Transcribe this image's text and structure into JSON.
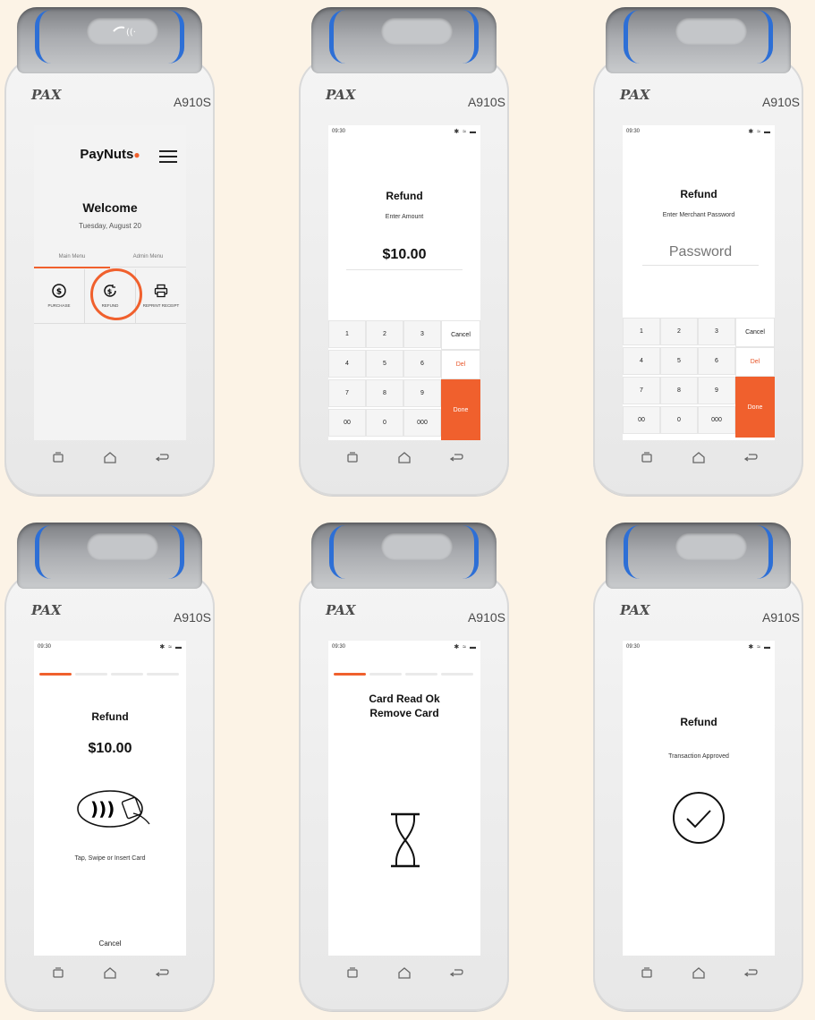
{
  "colors": {
    "background": "#fcf3e6",
    "accent": "#f0602d",
    "blue": "#2d6fd6"
  },
  "device": {
    "brand": "PAX",
    "model": "A910S"
  },
  "status": {
    "time": "09:30",
    "icons": "bluetooth-icon wifi-icon battery-icon"
  },
  "screen1": {
    "app_name": "PayNuts",
    "welcome": "Welcome",
    "date": "Tuesday, August 20",
    "tabs": [
      {
        "label": "Main Menu",
        "active": true
      },
      {
        "label": "Admin Menu",
        "active": false
      }
    ],
    "menu": [
      {
        "label": "PURCHASE",
        "icon": "dollar-circle-icon"
      },
      {
        "label": "REFUND",
        "icon": "refund-icon",
        "highlighted": true
      },
      {
        "label": "REPRINT RECEIPT",
        "icon": "printer-icon"
      }
    ]
  },
  "screen2": {
    "title": "Refund",
    "subtitle": "Enter Amount",
    "amount": "$10.00"
  },
  "screen3": {
    "title": "Refund",
    "subtitle": "Enter Merchant Password",
    "placeholder": "Password"
  },
  "keypad": {
    "keys": [
      "1",
      "2",
      "3",
      "4",
      "5",
      "6",
      "7",
      "8",
      "9",
      "00",
      "0",
      "000"
    ],
    "cancel": "Cancel",
    "del": "Del",
    "done": "Done"
  },
  "screen4": {
    "title": "Refund",
    "amount": "$10.00",
    "prompt": "Tap, Swipe or Insert Card",
    "cancel": "Cancel",
    "progress_step": 1,
    "progress_total": 4
  },
  "screen5": {
    "line1": "Card Read Ok",
    "line2": "Remove Card",
    "progress_step": 1,
    "progress_total": 4
  },
  "screen6": {
    "title": "Refund",
    "message": "Transaction Approved"
  }
}
